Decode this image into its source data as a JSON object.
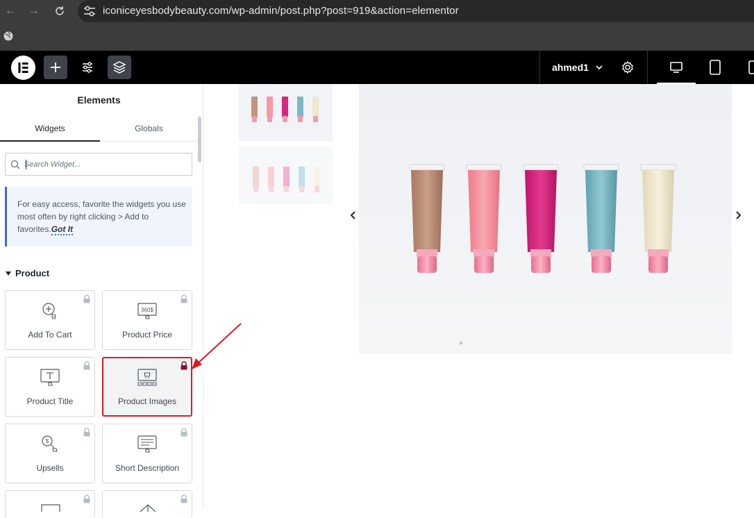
{
  "browser": {
    "url": "iconiceyesbodybeauty.com/wp-admin/post.php?post=919&action=elementor"
  },
  "topbar": {
    "user": "ahmed1"
  },
  "panel": {
    "title": "Elements",
    "tabs": [
      {
        "label": "Widgets",
        "active": true
      },
      {
        "label": "Globals",
        "active": false
      }
    ],
    "search_placeholder": "Search Widget...",
    "tip_text": "For easy access, favorite the widgets you use most often by right clicking > Add to favorites.",
    "tip_link": "Got It",
    "section": "Product",
    "widgets": [
      {
        "label": "Add To Cart",
        "icon": "add-to-cart-icon"
      },
      {
        "label": "Product Price",
        "icon": "product-price-icon"
      },
      {
        "label": "Product Title",
        "icon": "product-title-icon"
      },
      {
        "label": "Product Images",
        "icon": "product-images-icon"
      },
      {
        "label": "Upsells",
        "icon": "upsells-icon"
      },
      {
        "label": "Short Description",
        "icon": "short-description-icon"
      }
    ]
  },
  "colors": {
    "accent_blue": "#3a6ad4",
    "highlight_red": "#e0181f",
    "lock_active": "#8a0f3a",
    "tube_colors": [
      "#b98a72",
      "#f08a98",
      "#d01e78",
      "#6fb2bf",
      "#efe6c8"
    ]
  }
}
